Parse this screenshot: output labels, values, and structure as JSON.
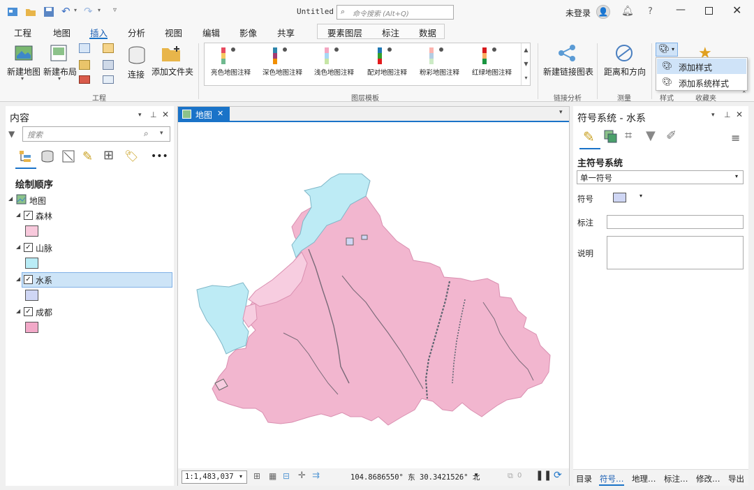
{
  "app": {
    "title": "Untitled",
    "command_search_placeholder": "命令搜索 (Alt+Q)",
    "user": "未登录",
    "help": "?"
  },
  "tabs": [
    "工程",
    "地图",
    "插入",
    "分析",
    "视图",
    "编辑",
    "影像",
    "共享"
  ],
  "context_tabs": [
    "要素图层",
    "标注",
    "数据"
  ],
  "ribbon": {
    "project": {
      "new_map": "新建地图",
      "new_layout": "新建布局",
      "connect": "连接",
      "add_folder": "添加文件夹",
      "group": "工程"
    },
    "templates": {
      "items": [
        "亮色地图注释",
        "深色地图注释",
        "浅色地图注释",
        "配对地图注释",
        "粉彩地图注释",
        "红绿地图注释"
      ],
      "group": "图层模板"
    },
    "link": {
      "new_link_chart": "新建链接图表",
      "group": "链接分析"
    },
    "measure": {
      "distance": "距离和方向",
      "group": "测量"
    },
    "styles": {
      "group": "样式"
    },
    "favorites": {
      "group": "收藏夹"
    }
  },
  "dropdown": {
    "items": [
      "添加样式",
      "添加系统样式"
    ]
  },
  "contents": {
    "title": "内容",
    "search_placeholder": "搜索",
    "drawing_order": "绘制顺序",
    "map": "地图",
    "layers": [
      {
        "name": "森林",
        "color": "#f8c9dc"
      },
      {
        "name": "山脉",
        "color": "#b9ecf6"
      },
      {
        "name": "水系",
        "color": "#cfd6f4"
      },
      {
        "name": "成都",
        "color": "#f2a9c8"
      }
    ]
  },
  "map_view": {
    "tab": "地图",
    "scale": "1:1,483,037",
    "coords": "104.8686550° 东  30.3421526° 北",
    "selection_count": "0"
  },
  "symbology": {
    "title": "符号系统 - 水系",
    "primary": "主符号系统",
    "mode": "单一符号",
    "symbol_label": "符号",
    "symbol_color": "#cfd6f4",
    "label_label": "标注",
    "desc_label": "说明"
  },
  "bottom_tabs": [
    "目录",
    "符号…",
    "地理…",
    "标注…",
    "修改…",
    "导出"
  ],
  "colors": {
    "accent": "#1a73c8",
    "polygon_fill": "#f2b6cf",
    "water_fill": "#bdebf5",
    "light_pink": "#f7cde0"
  }
}
